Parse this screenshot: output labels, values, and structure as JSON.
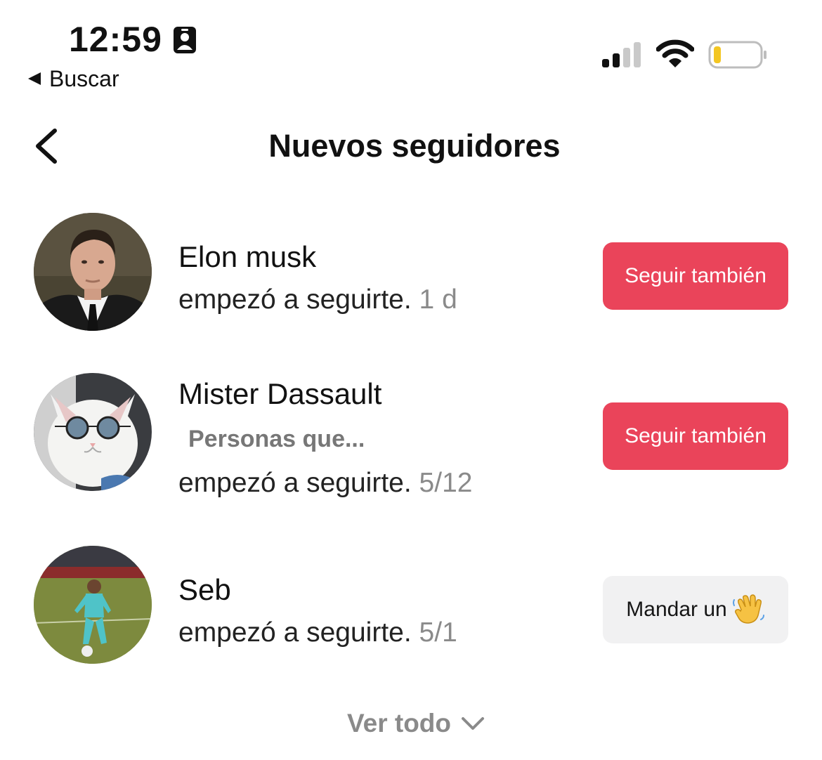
{
  "status_bar": {
    "time": "12:59",
    "back_app_label": "Buscar"
  },
  "header": {
    "title": "Nuevos seguidores"
  },
  "followers": [
    {
      "name": "Elon musk",
      "action": "empezó a seguirte.",
      "time": "1 d",
      "button_label": "Seguir también"
    },
    {
      "name": "Mister Dassault",
      "tagline": "Personas que...",
      "action": "empezó a seguirte.",
      "time": "5/12",
      "button_label": "Seguir también"
    },
    {
      "name": "Seb",
      "action": "empezó a seguirte.",
      "time": "5/1",
      "button_label": "Mandar un"
    }
  ],
  "footer": {
    "see_all_label": "Ver todo"
  },
  "colors": {
    "follow_button": "#ea445a",
    "wave_button": "#f1f1f2",
    "muted_text": "#8a8a8a"
  }
}
